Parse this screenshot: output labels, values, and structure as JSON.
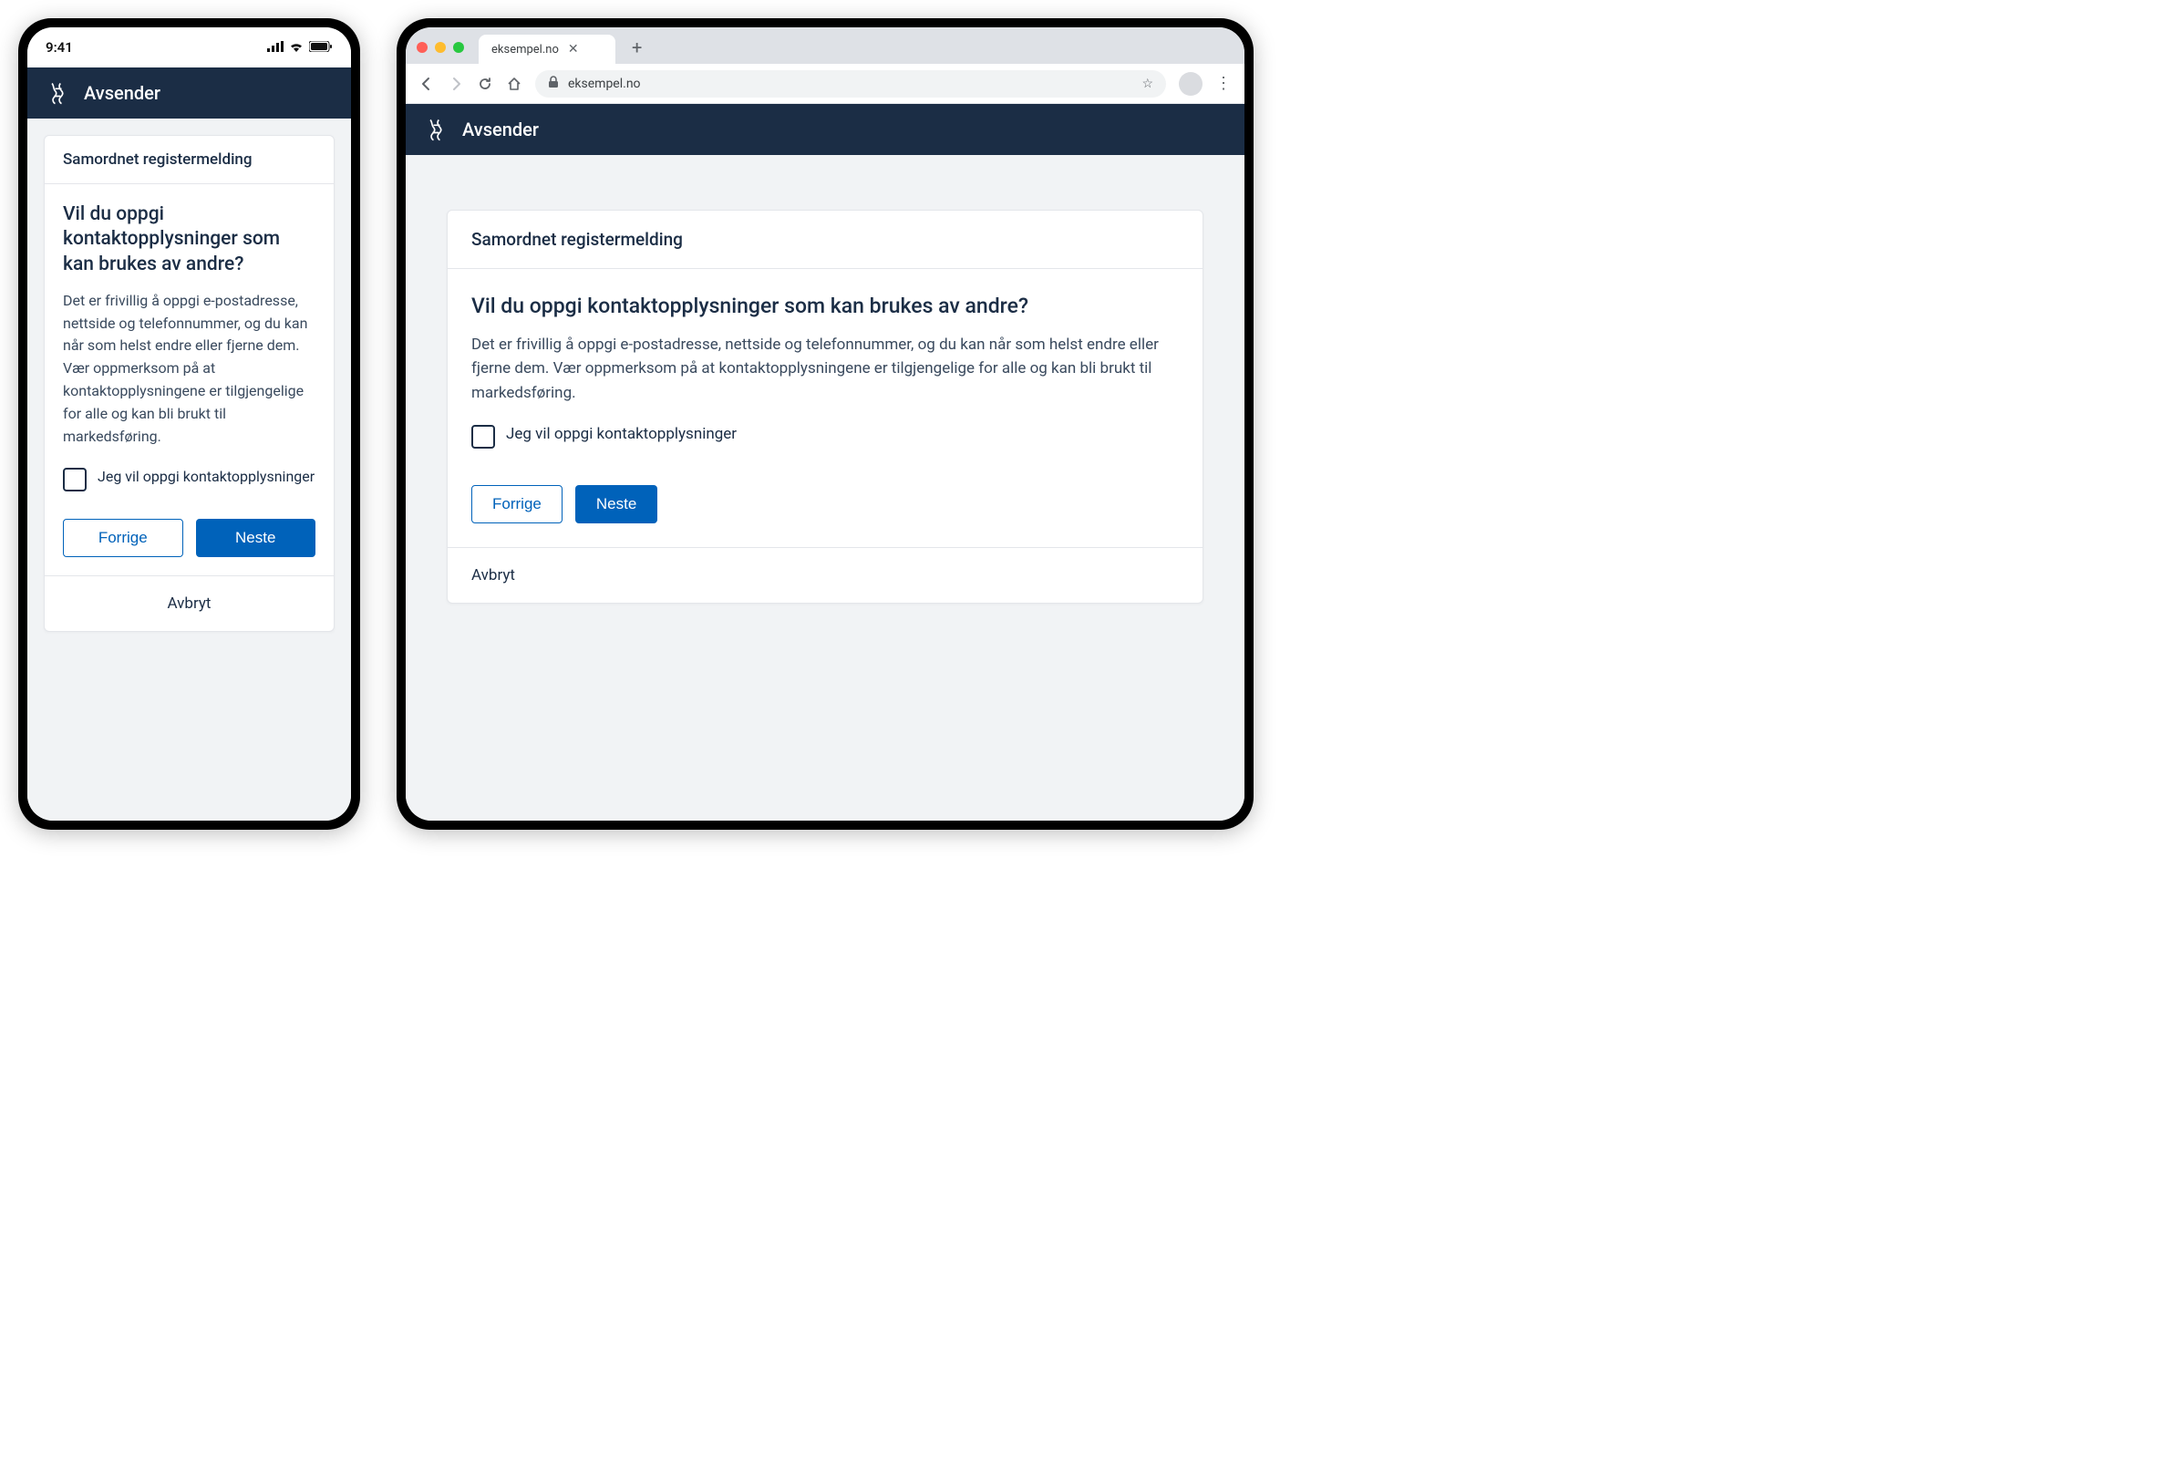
{
  "phone": {
    "status_time": "9:41"
  },
  "browser": {
    "tab_title": "eksempel.no",
    "url": "eksempel.no"
  },
  "app": {
    "sender_label": "Avsender"
  },
  "form": {
    "card_title": "Samordnet registermelding",
    "question": "Vil du oppgi kontaktopplysninger som kan brukes av andre?",
    "description": "Det er frivillig å oppgi e-postadresse, nettside og telefonnummer, og du kan når som helst endre eller fjerne dem. Vær oppmerksom på at kontaktopplysningene er tilgjengelige for alle og kan bli brukt til markedsføring.",
    "checkbox_label": "Jeg vil oppgi kontaktopplysninger",
    "prev_label": "Forrige",
    "next_label": "Neste",
    "cancel_label": "Avbryt"
  }
}
